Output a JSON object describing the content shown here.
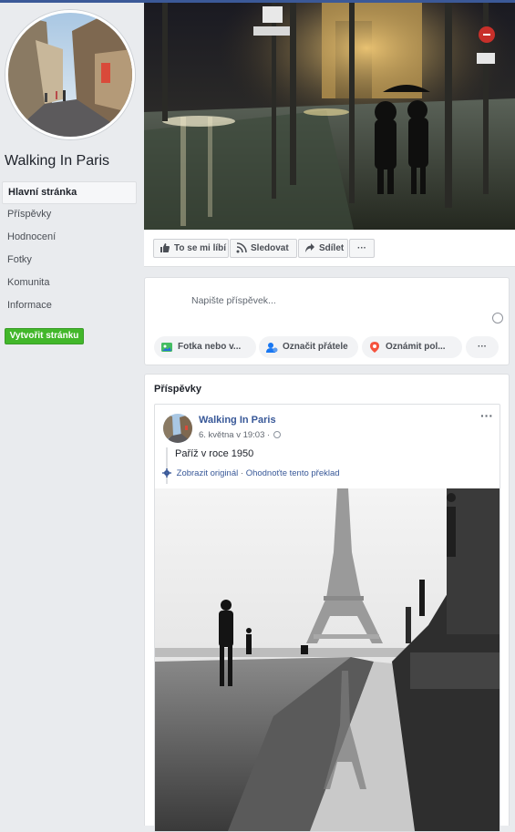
{
  "page": {
    "name": "Walking In Paris"
  },
  "sidebar": {
    "items": [
      {
        "label": "Hlavní stránka"
      },
      {
        "label": "Příspěvky"
      },
      {
        "label": "Hodnocení"
      },
      {
        "label": "Fotky"
      },
      {
        "label": "Komunita"
      },
      {
        "label": "Informace"
      }
    ],
    "create_label": "Vytvořit stránku"
  },
  "actions": {
    "like": "To se mi líbí",
    "follow": "Sledovat",
    "share": "Sdílet",
    "more": "···"
  },
  "composer": {
    "placeholder": "Napište příspěvek...",
    "photo": "Fotka nebo v...",
    "tag": "Označit přátele",
    "checkin": "Oznámit pol...",
    "more": "···"
  },
  "posts": {
    "title": "Příspěvky",
    "items": [
      {
        "author": "Walking In Paris",
        "time": "6. května v 19:03 ·",
        "text": "Paříž v roce 1950",
        "show_original": "Zobrazit originál",
        "sep": " · ",
        "rate": "Ohodnoťte tento překlad",
        "menu": "···"
      }
    ]
  },
  "colors": {
    "brand": "#3b5998",
    "link": "#385898",
    "create": "#42b72a"
  },
  "icons": [
    "thumbs-up-icon",
    "rss-icon",
    "share-icon",
    "photo-icon",
    "tag-friends-icon",
    "location-pin-icon",
    "globe-icon",
    "gear-icon",
    "emoji-icon"
  ]
}
